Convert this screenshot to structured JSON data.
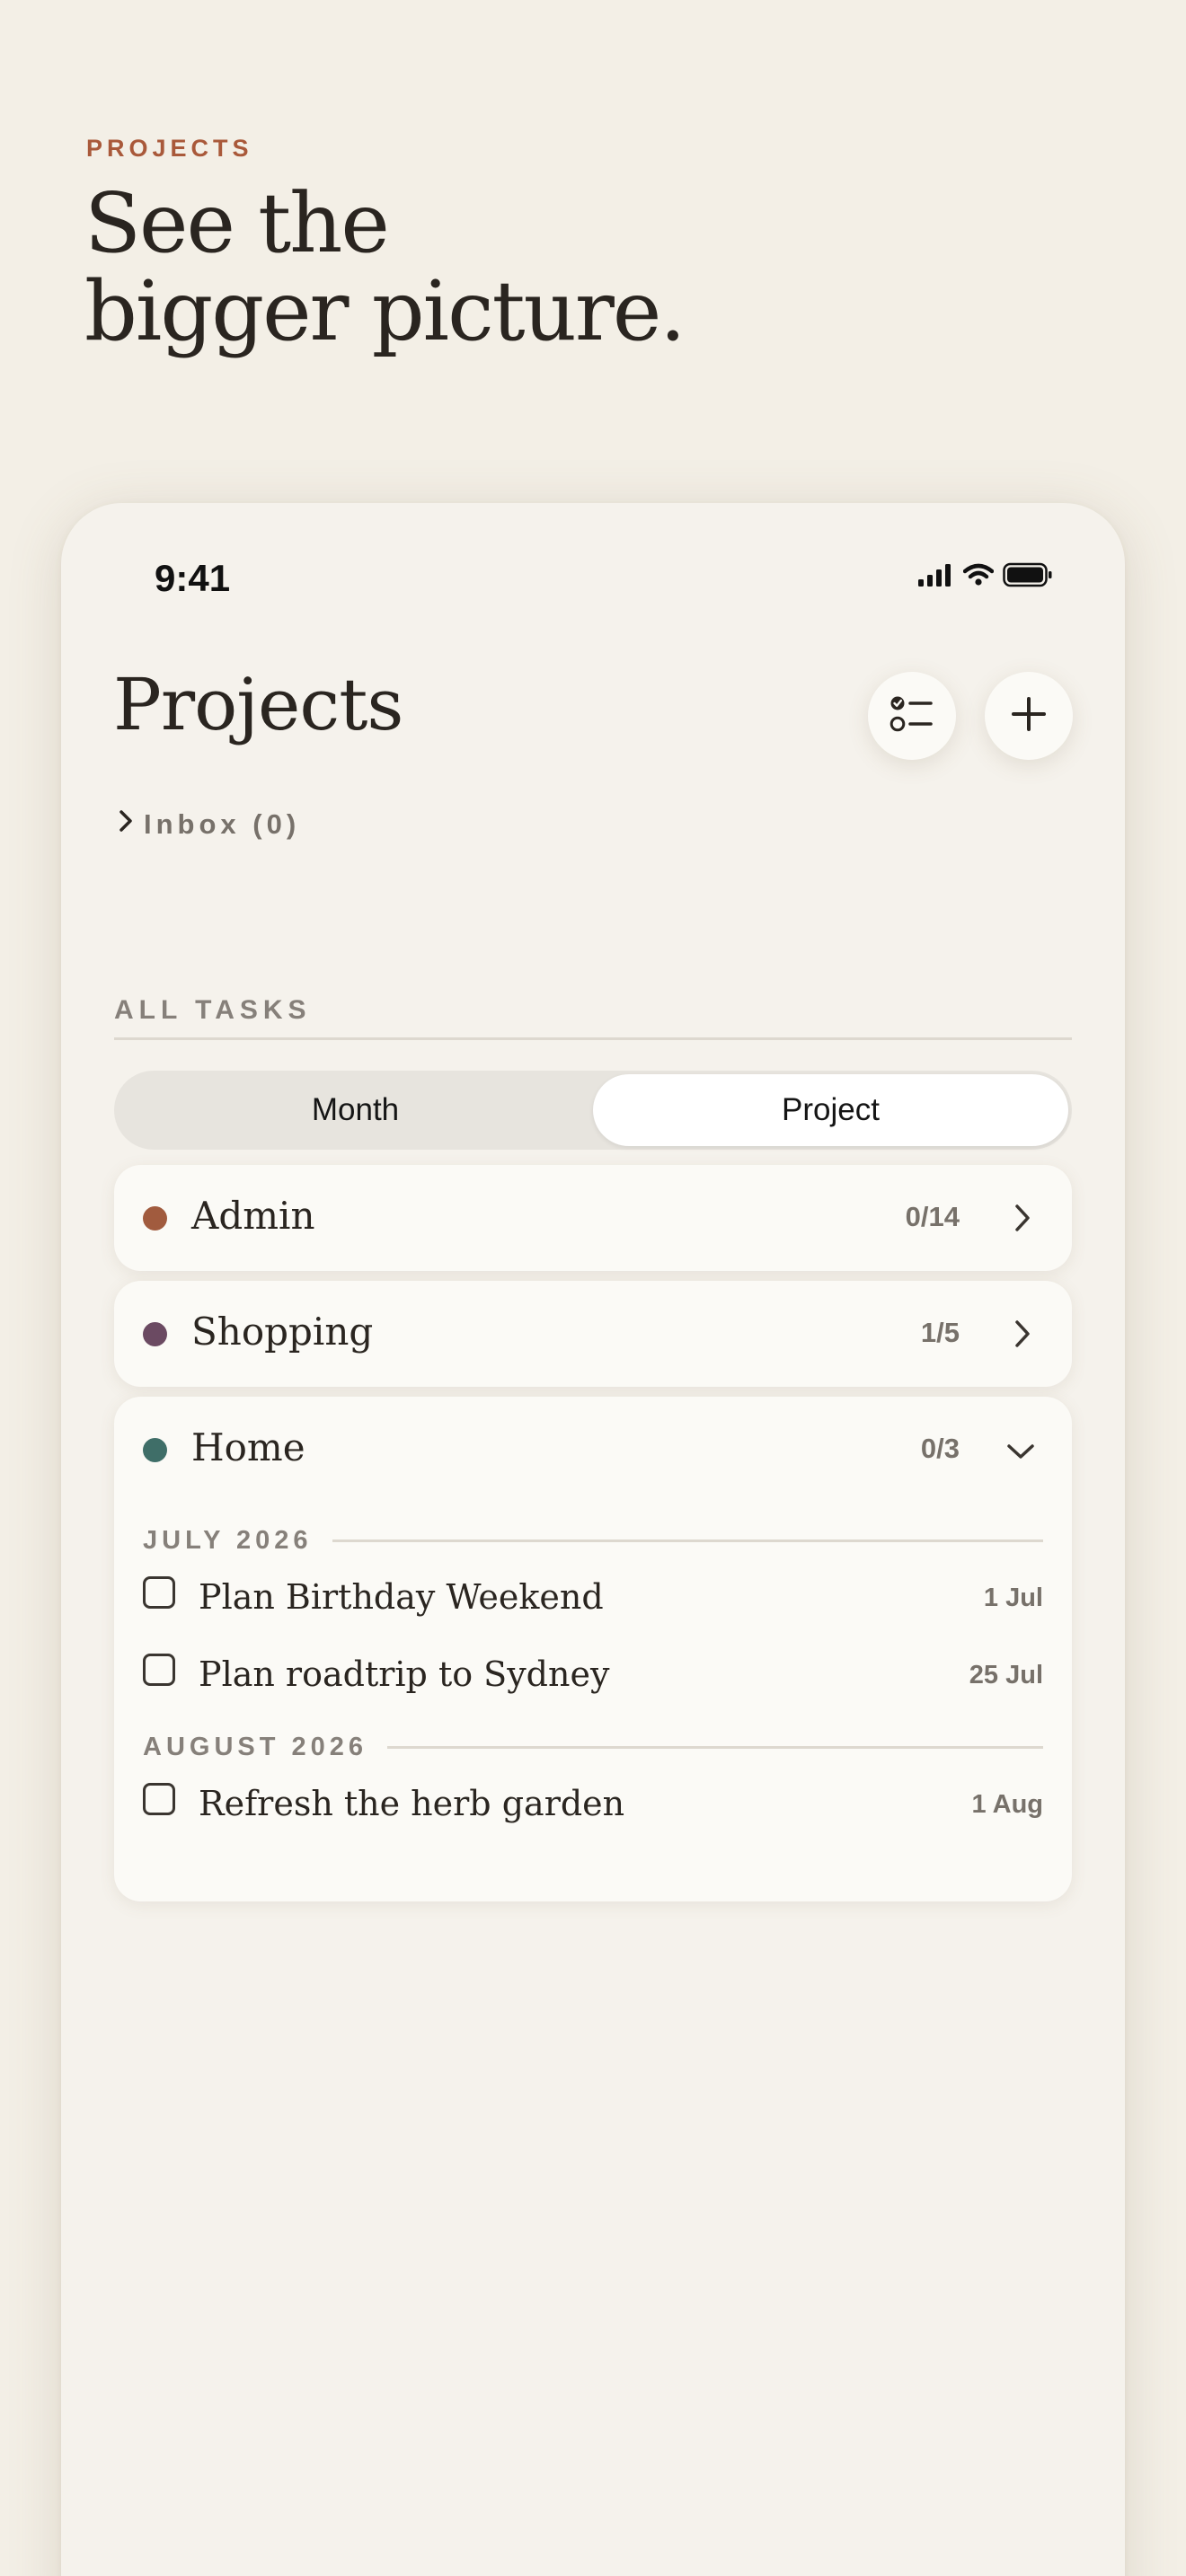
{
  "hero": {
    "eyebrow": "PROJECTS",
    "headline_line1": "See the",
    "headline_line2": "bigger picture."
  },
  "status_bar": {
    "time": "9:41"
  },
  "screen": {
    "title": "Projects",
    "inbox_label": "Inbox (0)",
    "section_label": "ALL TASKS"
  },
  "segmented": {
    "options": [
      "Month",
      "Project"
    ],
    "selected": "Project"
  },
  "projects": [
    {
      "name": "Admin",
      "count": "0/14",
      "color": "#A15B3E",
      "expanded": false
    },
    {
      "name": "Shopping",
      "count": "1/5",
      "color": "#6B4A62",
      "expanded": false
    },
    {
      "name": "Home",
      "count": "0/3",
      "color": "#3F6E68",
      "expanded": true,
      "groups": [
        {
          "month": "JULY 2026",
          "tasks": [
            {
              "title": "Plan Birthday Weekend",
              "date": "1 Jul"
            },
            {
              "title": "Plan roadtrip to Sydney",
              "date": "25 Jul"
            }
          ]
        },
        {
          "month": "AUGUST 2026",
          "tasks": [
            {
              "title": "Refresh the herb garden",
              "date": "1 Aug"
            }
          ]
        }
      ]
    }
  ],
  "colors": {
    "accent": "#A9593A",
    "background": "#F3EFE6",
    "card": "#FBFAF6"
  }
}
